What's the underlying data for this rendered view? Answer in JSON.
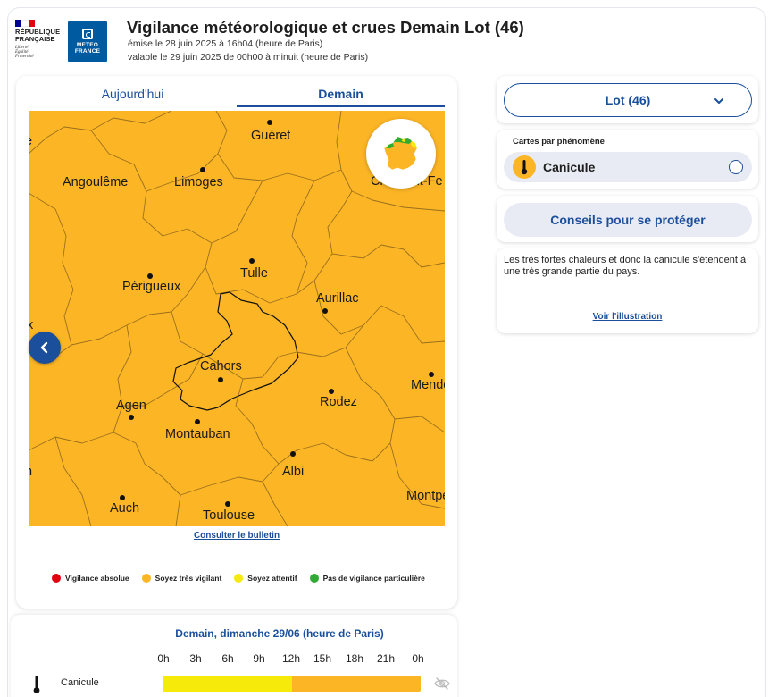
{
  "header": {
    "republique": "RÉPUBLIQUE\nFRANÇAISE",
    "republique_l1": "RÉPUBLIQUE",
    "republique_l2": "FRANÇAISE",
    "motto_l1": "Liberté",
    "motto_l2": "Égalité",
    "motto_l3": "Fraternité",
    "mf_l1": "METEO",
    "mf_l2": "FRANCE",
    "title": "Vigilance météorologique et crues Demain Lot (46)",
    "emitted": "émise le 28 juin 2025 à 16h04 (heure de Paris)",
    "valid": "valable le 29 juin 2025 de 00h00 à minuit (heure de Paris)"
  },
  "tabs": [
    {
      "label": "Aujourd'hui",
      "active": false
    },
    {
      "label": "Demain",
      "active": true
    }
  ],
  "map": {
    "fill_color": "#fcb525",
    "cities": [
      "Guéret",
      "Angoulême",
      "Limoges",
      "Clermont-Ferrand",
      "Périgueux",
      "Tulle",
      "Aurillac",
      "Cahors",
      "Agen",
      "Rodez",
      "Mende",
      "Montauban",
      "Albi",
      "Auch",
      "Toulouse",
      "Montpellier"
    ],
    "selected_department": "Cahors"
  },
  "links": {
    "bulletin": "Consulter le bulletin",
    "illustration": "Voir l'illustration"
  },
  "legend": [
    {
      "label": "Vigilance absolue",
      "color": "#e1000f"
    },
    {
      "label": "Soyez très vigilant",
      "color": "#fcb525"
    },
    {
      "label": "Soyez attentif",
      "color": "#f5ea0a"
    },
    {
      "label": "Pas de vigilance particulière",
      "color": "#31aa35"
    }
  ],
  "side": {
    "department": "Lot (46)",
    "phenomena_title": "Cartes par phénomène",
    "phenomenon": "Canicule",
    "advice_button": "Conseils pour se protéger",
    "description": "Les très fortes chaleurs et donc la canicule s'étendent à une très grande partie du pays."
  },
  "timeline": {
    "title": "Demain, dimanche 29/06 (heure de Paris)",
    "hours": [
      "0h",
      "3h",
      "6h",
      "9h",
      "12h",
      "15h",
      "18h",
      "21h",
      "0h"
    ],
    "row_label": "Canicule",
    "segments": [
      {
        "from": "0h",
        "to": "12h",
        "level": "Soyez attentif",
        "color": "#f5ea0a"
      },
      {
        "from": "12h",
        "to": "0h",
        "level": "Soyez très vigilant",
        "color": "#fcb525"
      }
    ]
  }
}
